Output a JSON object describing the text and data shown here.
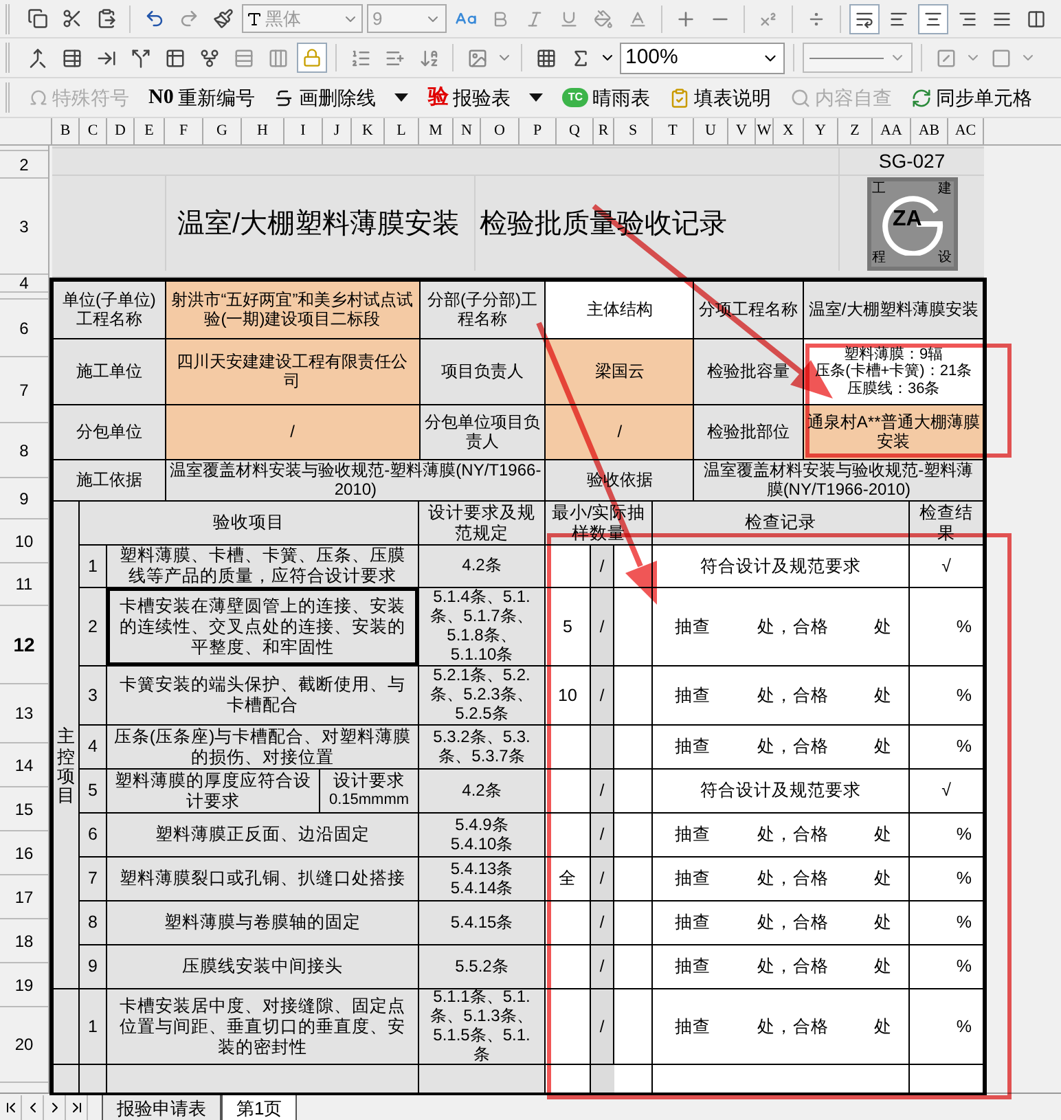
{
  "toolbar_1": {
    "font_name": "黑体",
    "font_size": "9"
  },
  "toolbar_2": {
    "zoom": "100%"
  },
  "toolbar_3": [
    {
      "label": "特殊符号",
      "disabled": true,
      "dropdown": false
    },
    {
      "badge": "N0",
      "label": "重新编号",
      "disabled": false,
      "dropdown": false
    },
    {
      "label": "画删除线",
      "disabled": false,
      "dropdown": true
    },
    {
      "badge": "验",
      "label": "报验表",
      "disabled": false,
      "dropdown": true
    },
    {
      "badge": "TC",
      "label": "晴雨表",
      "disabled": false,
      "dropdown": false
    },
    {
      "label": "填表说明",
      "disabled": false,
      "dropdown": false
    },
    {
      "label": "内容自查",
      "disabled": true,
      "dropdown": false
    },
    {
      "label": "同步单元格",
      "disabled": false,
      "dropdown": false
    }
  ],
  "columns": [
    "B",
    "C",
    "D",
    "E",
    "F",
    "G",
    "H",
    "I",
    "J",
    "K",
    "L",
    "M",
    "N",
    "O",
    "P",
    "Q",
    "R",
    "S",
    "T",
    "U",
    "V",
    "W",
    "X",
    "Y",
    "Z",
    "AA",
    "AB",
    "AC"
  ],
  "row_numbers": [
    {
      "label": "2",
      "selected": false
    },
    {
      "label": "3",
      "selected": false
    },
    {
      "label": "4",
      "selected": false
    },
    {
      "label": "6",
      "selected": false
    },
    {
      "label": "7",
      "selected": false
    },
    {
      "label": "8",
      "selected": false
    },
    {
      "label": "9",
      "selected": false
    },
    {
      "label": "10",
      "selected": false
    },
    {
      "label": "11",
      "selected": false
    },
    {
      "label": "12",
      "selected": true
    },
    {
      "label": "13",
      "selected": false
    },
    {
      "label": "14",
      "selected": false
    },
    {
      "label": "15",
      "selected": false
    },
    {
      "label": "16",
      "selected": false
    },
    {
      "label": "17",
      "selected": false
    },
    {
      "label": "18",
      "selected": false
    },
    {
      "label": "19",
      "selected": false
    },
    {
      "label": "20",
      "selected": false
    }
  ],
  "sheet": {
    "code": "SG-027",
    "title": [
      "温室/大棚塑料薄膜安装",
      "检验批质量验收记录"
    ],
    "logo": {
      "text": "ZA",
      "corners": [
        "工",
        "建",
        "程",
        "设"
      ]
    }
  },
  "info_rows": [
    {
      "cells": [
        {
          "kind": "label",
          "text": "单位(子单位)工程名称"
        },
        {
          "kind": "entry",
          "text": "射洪市“五好两宜”和美乡村试点试验(一期)建设项目二标段"
        },
        {
          "kind": "label",
          "text": "分部(子分部)工程名称"
        },
        {
          "kind": "computed",
          "text": "主体结构"
        },
        {
          "kind": "label",
          "text": "分项工程名称"
        },
        {
          "kind": "plain",
          "text": "温室/大棚塑料薄膜安装"
        }
      ]
    },
    {
      "cells": [
        {
          "kind": "label",
          "text": "施工单位"
        },
        {
          "kind": "entry",
          "text": "四川天安建建设工程有限责任公司"
        },
        {
          "kind": "label",
          "text": "项目负责人"
        },
        {
          "kind": "entry",
          "text": "梁国云"
        },
        {
          "kind": "label",
          "text": "检验批容量"
        },
        {
          "kind": "computed",
          "lines": [
            "塑料薄膜：9辐",
            "压条(卡槽+卡簧)：21条",
            "压膜线：36条"
          ]
        }
      ]
    },
    {
      "cells": [
        {
          "kind": "label",
          "text": "分包单位"
        },
        {
          "kind": "entry",
          "text": "/"
        },
        {
          "kind": "label",
          "text": "分包单位项目负责人"
        },
        {
          "kind": "entry",
          "text": "/"
        },
        {
          "kind": "label",
          "text": "检验批部位"
        },
        {
          "kind": "entry",
          "text": "通泉村A**普通大棚薄膜安装"
        }
      ]
    },
    {
      "cells": [
        {
          "kind": "label",
          "text": "施工依据"
        },
        {
          "kind": "plain",
          "text": "温室覆盖材料安装与验收规范-塑料薄膜(NY/T1966-2010)"
        },
        {
          "kind": "label",
          "text": "验收依据"
        },
        {
          "kind": "plain",
          "text": "温室覆盖材料安装与验收规范-塑料薄膜(NY/T1966-2010)"
        }
      ]
    }
  ],
  "table": {
    "headers": [
      "验收项目",
      "设计要求及规范规定",
      "最小/实际抽样数量",
      "检查记录",
      "检查结果"
    ],
    "group": "主控项目",
    "items": [
      {
        "no": "1",
        "text": "塑料薄膜、卡槽、卡簧、压条、压膜线等产品的质量，应符合设计要求",
        "spec": [
          "4.2条"
        ],
        "slash": "/",
        "record": {
          "kind": "conform",
          "text": "符合设计及规范要求"
        },
        "result": "√",
        "selected": false
      },
      {
        "no": "2",
        "text": "卡槽安装在薄壁圆管上的连接、安装的连续性、交叉点处的连接、安装的平整度、和牢固性",
        "spec": [
          "5.1.4条、5.1.",
          "条、5.1.7条、",
          "5.1.8条、",
          "5.1.10条"
        ],
        "sample": "5",
        "slash": "/",
        "record": {
          "kind": "sampling",
          "parts": [
            "抽查",
            "处，合格",
            "处"
          ]
        },
        "result": "%",
        "selected": true
      },
      {
        "no": "3",
        "text": "卡簧安装的端头保护、截断使用、与卡槽配合",
        "spec": [
          "5.2.1条、5.2.",
          "条、5.2.3条、",
          "5.2.5条"
        ],
        "sample": "10",
        "slash": "/",
        "record": {
          "kind": "sampling",
          "parts": [
            "抽查",
            "处，合格",
            "处"
          ]
        },
        "result": "%",
        "selected": false
      },
      {
        "no": "4",
        "text": "压条(压条座)与卡槽配合、对塑料薄膜的损伤、对接位置",
        "spec": [
          "5.3.2条、5.3.",
          "条、5.3.7条"
        ],
        "record": {
          "kind": "sampling",
          "parts": [
            "抽查",
            "处，合格",
            "处"
          ]
        },
        "result": "%",
        "selected": false
      },
      {
        "no": "5",
        "text": "塑料薄膜的厚度应符合设计要求",
        "requirement": {
          "label": "设计要求",
          "value": "0.15mmmm"
        },
        "spec": [
          "4.2条"
        ],
        "slash": "/",
        "record": {
          "kind": "conform",
          "text": "符合设计及规范要求"
        },
        "result": "√",
        "selected": false
      },
      {
        "no": "6",
        "text": "塑料薄膜正反面、边沿固定",
        "spec": [
          "5.4.9条",
          "5.4.10条"
        ],
        "slash": "/",
        "record": {
          "kind": "sampling",
          "parts": [
            "抽查",
            "处，合格",
            "处"
          ]
        },
        "result": "%",
        "selected": false
      },
      {
        "no": "7",
        "text": "塑料薄膜裂口或孔铜、扒缝口处搭接",
        "spec": [
          "5.4.13条",
          "5.4.14条"
        ],
        "sample": "全",
        "slash": "/",
        "record": {
          "kind": "sampling",
          "parts": [
            "抽查",
            "处，合格",
            "处"
          ]
        },
        "result": "%",
        "selected": false
      },
      {
        "no": "8",
        "text": "塑料薄膜与卷膜轴的固定",
        "spec": [
          "5.4.15条"
        ],
        "slash": "/",
        "record": {
          "kind": "sampling",
          "parts": [
            "抽查",
            "处，合格",
            "处"
          ]
        },
        "result": "%",
        "selected": false
      },
      {
        "no": "9",
        "text": "压膜线安装中间接头",
        "spec": [
          "5.5.2条"
        ],
        "slash": "/",
        "record": {
          "kind": "sampling",
          "parts": [
            "抽查",
            "处，合格",
            "处"
          ]
        },
        "result": "%",
        "selected": false
      }
    ],
    "next_group_items": [
      {
        "no": "1",
        "text": "卡槽安装居中度、对接缝隙、固定点位置与间距、垂直切口的垂直度、安装的密封性",
        "spec": [
          "5.1.1条、5.1.",
          "条、5.1.3条、",
          "5.1.5条、5.1.",
          "条"
        ],
        "slash": "/",
        "record": {
          "kind": "sampling",
          "parts": [
            "抽查",
            "处，合格",
            "处"
          ]
        },
        "result": "%",
        "selected": false
      }
    ]
  },
  "sheet_tabs": [
    {
      "label": "报验申请表",
      "selected": false
    },
    {
      "label": "第1页",
      "selected": true
    }
  ]
}
